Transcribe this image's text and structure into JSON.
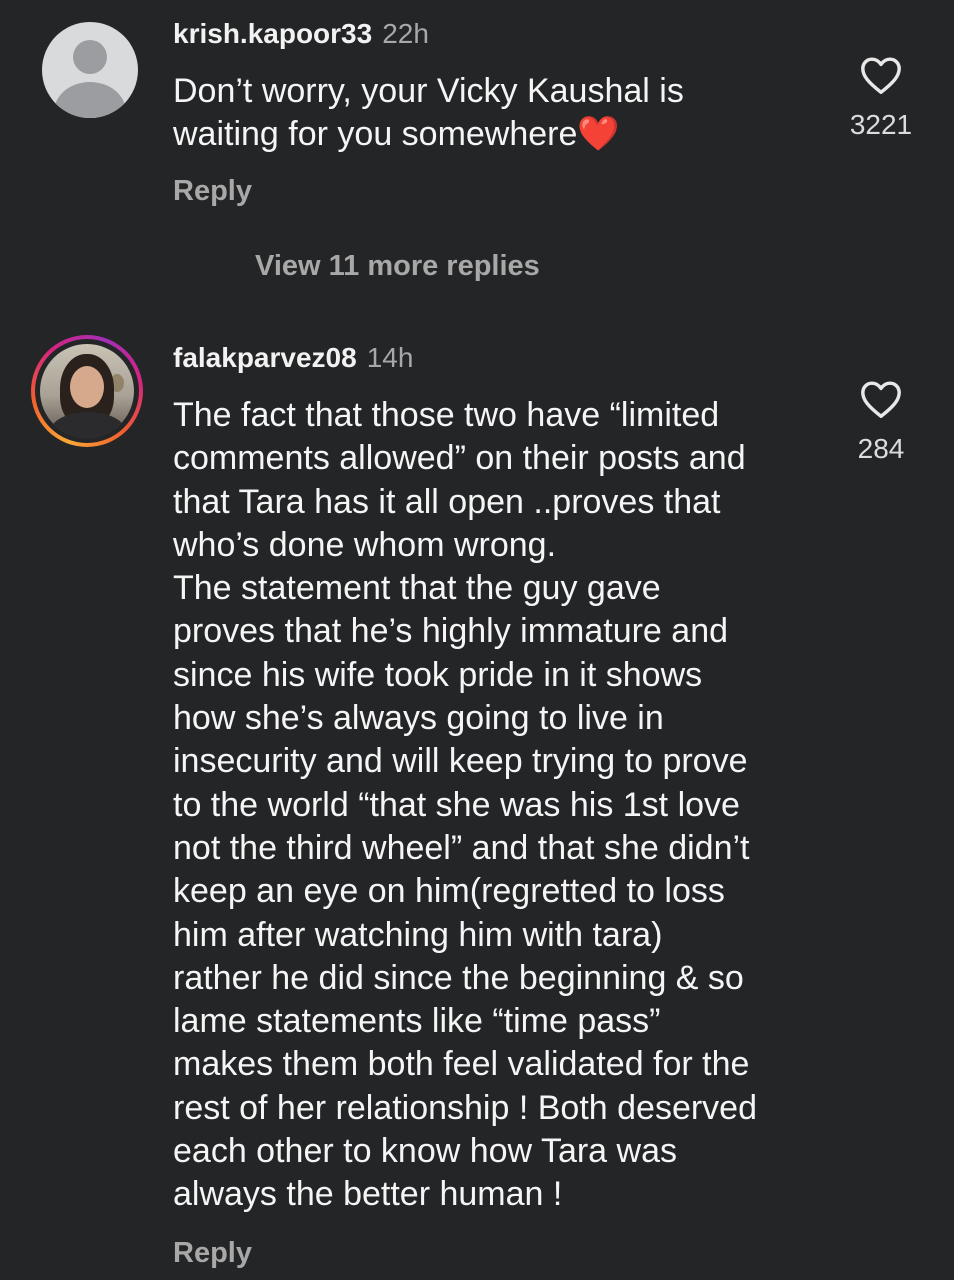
{
  "comments": [
    {
      "username": "krish.kapoor33",
      "time": "22h",
      "text": "Don’t worry, your Vicky Kaushal is\nwaiting for you somewhere❤️",
      "likes": "3221",
      "reply_label": "Reply",
      "view_replies": "View 11 more replies",
      "avatar": "default-avatar-icon"
    },
    {
      "username": "falakparvez08",
      "time": "14h",
      "text": "The fact that those two have “limited\ncomments allowed” on their posts and\nthat Tara has it all open ..proves that\nwho’s done whom wrong.\nThe statement that the guy gave\nproves that he’s highly immature and\nsince his wife took pride in it shows\nhow she’s always going to live in\ninsecurity and will keep trying to prove\nto the world “that she was his 1st love\nnot the third wheel” and that she didn’t\nkeep an eye on him(regretted to loss\nhim after watching him with tara)\nrather he did since the beginning & so\nlame statements like “time pass”\nmakes them both feel validated for the\nrest of her relationship ! Both deserved\neach other to know how Tara was\nalways the better human !",
      "likes": "284",
      "reply_label": "Reply",
      "avatar": "profile-photo-with-story-ring"
    }
  ],
  "colors": {
    "background": "#242527",
    "text": "#f5f5f5",
    "muted": "#a8a8a8"
  }
}
